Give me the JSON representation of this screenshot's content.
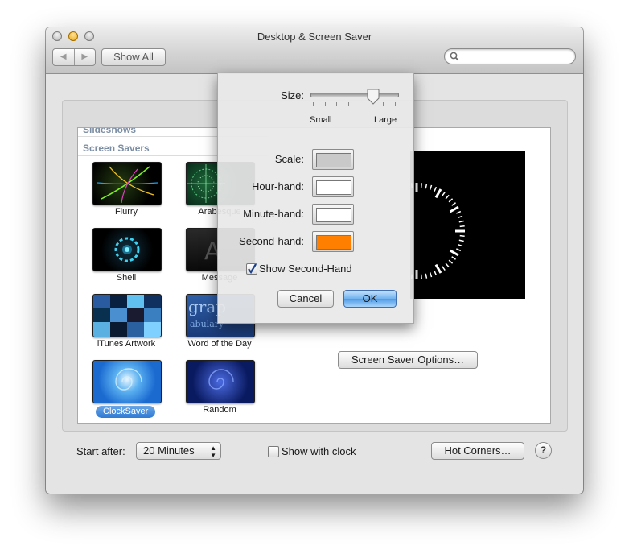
{
  "window": {
    "title": "Desktop & Screen Saver"
  },
  "toolbar": {
    "back": "◀",
    "forward": "▶",
    "show_all": "Show All",
    "search_placeholder": ""
  },
  "list": {
    "section_cut": "Slideshows",
    "section": "Screen Savers",
    "items": [
      {
        "label": "Flurry",
        "selected": false
      },
      {
        "label": "Arabesque",
        "selected": false
      },
      {
        "label": "Shell",
        "selected": false
      },
      {
        "label": "Message",
        "selected": false
      },
      {
        "label": "iTunes Artwork",
        "selected": false
      },
      {
        "label": "Word of the Day",
        "selected": false
      },
      {
        "label": "ClockSaver",
        "selected": true
      },
      {
        "label": "Random",
        "selected": false
      }
    ]
  },
  "preview": {
    "options_button": "Screen Saver Options…"
  },
  "bottom": {
    "start_after_label": "Start after:",
    "start_after_value": "20 Minutes",
    "show_with_clock_label": "Show with clock",
    "show_with_clock_checked": false,
    "hot_corners": "Hot Corners…",
    "help": "?"
  },
  "sheet": {
    "size_label": "Size:",
    "size_min_label": "Small",
    "size_max_label": "Large",
    "size_value": 0.75,
    "scale_label": "Scale:",
    "hour_label": "Hour-hand:",
    "minute_label": "Minute-hand:",
    "second_label": "Second-hand:",
    "colors": {
      "scale": "#c9c9c9",
      "hour": "#ffffff",
      "minute": "#ffffff",
      "second": "#ff8000"
    },
    "show_second_label": "Show Second-Hand",
    "show_second_checked": true,
    "cancel": "Cancel",
    "ok": "OK"
  }
}
